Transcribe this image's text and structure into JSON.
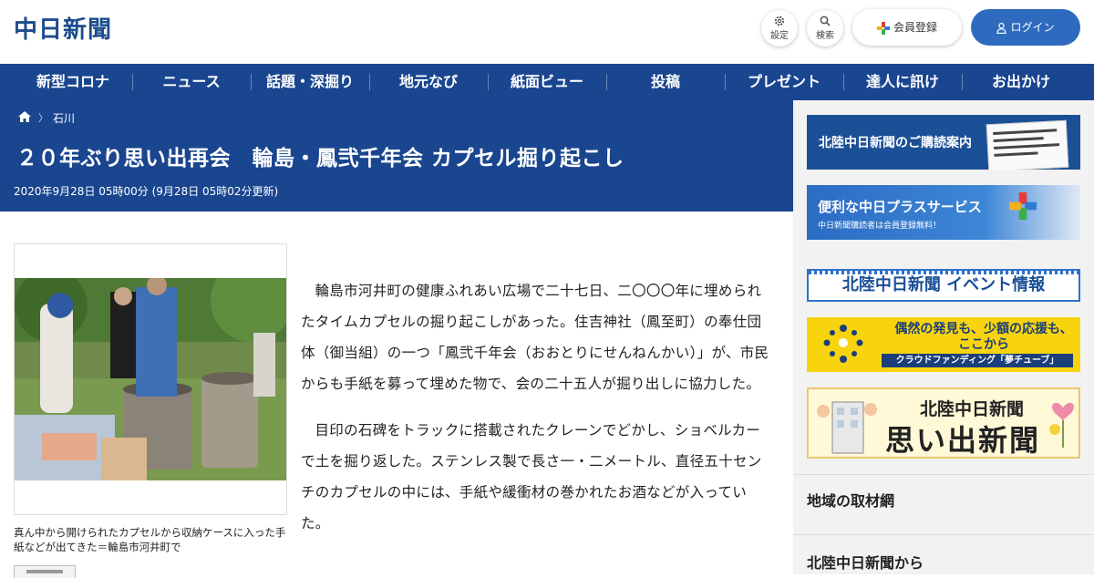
{
  "header": {
    "logo": "中日新聞",
    "settings_label": "設定",
    "search_label": "検索",
    "register_label": "会員登録",
    "login_label": "ログイン"
  },
  "nav": {
    "items": [
      "新型コロナ",
      "ニュース",
      "話題・深掘り",
      "地元なび",
      "紙面ビュー",
      "投稿",
      "プレゼント",
      "達人に訊け",
      "お出かけ"
    ]
  },
  "breadcrumb": {
    "category": "石川"
  },
  "article": {
    "title": "２０年ぶり思い出再会　輪島・鳳弐千年会 カプセル掘り起こし",
    "date": "2020年9月28日 05時00分 (9月28日 05時02分更新)",
    "photo_caption": "真ん中から開けられたカプセルから収納ケースに入った手紙などが出てきた＝輪島市河井町で",
    "paragraphs": [
      "輪島市河井町の健康ふれあい広場で二十七日、二〇〇〇年に埋められたタイムカプセルの掘り起こしがあった。住吉神社（鳳至町）の奉仕団体（御当組）の一つ「鳳弐千年会（おおとりにせんねんかい）」が、市民からも手紙を募って埋めた物で、会の二十五人が掘り出しに協力した。",
      "目印の石碑をトラックに搭載されたクレーンでどかし、ショベルカーで土を掘り返した。ステンレス製で長さ一・二メートル、直径五十センチのカプセルの中には、手紙や緩衝材の巻かれたお酒などが入っていた。"
    ]
  },
  "sidebar": {
    "banner1": "北陸中日新聞のご購読案内",
    "banner2_title": "便利な中日プラスサービス",
    "banner2_sub": "中日新聞購読者は会員登録無料！",
    "banner3": "北陸中日新聞 イベント情報",
    "banner4_text": "偶然の発見も、少額の応援も、ここから",
    "banner4_bar": "クラウドファンディング「夢チューブ」",
    "banner5_line1": "北陸中日新聞",
    "banner5_line2": "思い出新聞",
    "section1": "地域の取材網",
    "section2": "北陸中日新聞から"
  },
  "colors": {
    "brand": "#1a4690",
    "login_button": "#2e6bbf",
    "logo": "#1d4c8d"
  }
}
